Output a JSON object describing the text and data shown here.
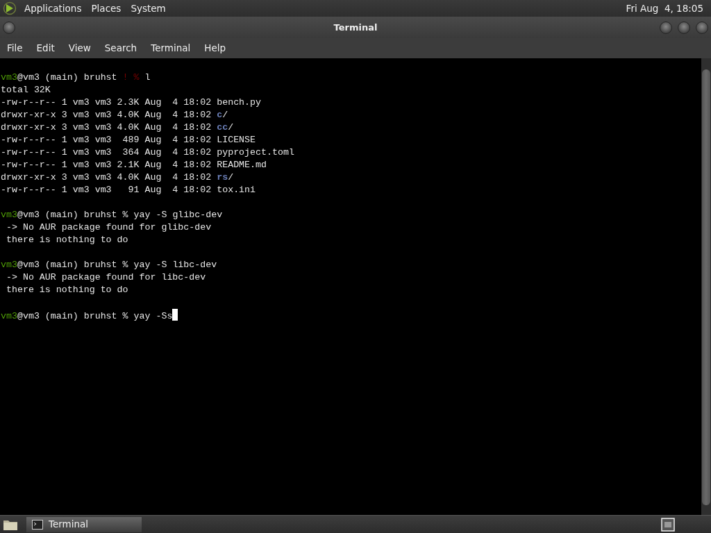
{
  "top_panel": {
    "menus": [
      "Applications",
      "Places",
      "System"
    ],
    "clock": "Fri Aug  4, 18:05"
  },
  "window": {
    "title": "Terminal"
  },
  "menu_bar": [
    "File",
    "Edit",
    "View",
    "Search",
    "Terminal",
    "Help"
  ],
  "terminal": {
    "blocks": [
      {
        "lines": [
          [
            {
              "text": "vm3",
              "kind": "user"
            },
            {
              "text": "@vm3 (main) bruhst ",
              "kind": "plain"
            },
            {
              "text": "! %",
              "kind": "alert"
            },
            {
              "text": " l",
              "kind": "plain"
            }
          ],
          [
            {
              "text": "total 32K",
              "kind": "plain"
            }
          ],
          [
            {
              "text": "-rw-r--r-- 1 vm3 vm3 2.3K Aug  4 18:02 bench.py",
              "kind": "plain"
            }
          ],
          [
            {
              "text": "drwxr-xr-x 3 vm3 vm3 4.0K Aug  4 18:02 ",
              "kind": "plain"
            },
            {
              "text": "c",
              "kind": "dir"
            },
            {
              "text": "/",
              "kind": "plain"
            }
          ],
          [
            {
              "text": "drwxr-xr-x 3 vm3 vm3 4.0K Aug  4 18:02 ",
              "kind": "plain"
            },
            {
              "text": "cc",
              "kind": "dir"
            },
            {
              "text": "/",
              "kind": "plain"
            }
          ],
          [
            {
              "text": "-rw-r--r-- 1 vm3 vm3  489 Aug  4 18:02 LICENSE",
              "kind": "plain"
            }
          ],
          [
            {
              "text": "-rw-r--r-- 1 vm3 vm3  364 Aug  4 18:02 pyproject.toml",
              "kind": "plain"
            }
          ],
          [
            {
              "text": "-rw-r--r-- 1 vm3 vm3 2.1K Aug  4 18:02 README.md",
              "kind": "plain"
            }
          ],
          [
            {
              "text": "drwxr-xr-x 3 vm3 vm3 4.0K Aug  4 18:02 ",
              "kind": "plain"
            },
            {
              "text": "rs",
              "kind": "dir"
            },
            {
              "text": "/",
              "kind": "plain"
            }
          ],
          [
            {
              "text": "-rw-r--r-- 1 vm3 vm3   91 Aug  4 18:02 tox.ini",
              "kind": "plain"
            }
          ]
        ]
      },
      {
        "lines": [
          [
            {
              "text": "vm3",
              "kind": "user"
            },
            {
              "text": "@vm3 (main) bruhst % yay -S glibc-dev",
              "kind": "plain"
            }
          ],
          [
            {
              "text": " -> No AUR package found for glibc-dev",
              "kind": "plain"
            }
          ],
          [
            {
              "text": " there is nothing to do",
              "kind": "plain"
            }
          ]
        ]
      },
      {
        "lines": [
          [
            {
              "text": "vm3",
              "kind": "user"
            },
            {
              "text": "@vm3 (main) bruhst % yay -S libc-dev",
              "kind": "plain"
            }
          ],
          [
            {
              "text": " -> No AUR package found for libc-dev",
              "kind": "plain"
            }
          ],
          [
            {
              "text": " there is nothing to do",
              "kind": "plain"
            }
          ]
        ]
      },
      {
        "lines": [
          [
            {
              "text": "vm3",
              "kind": "user"
            },
            {
              "text": "@vm3 (main) bruhst % yay -Ss",
              "kind": "plain"
            }
          ]
        ],
        "cursor": true
      }
    ]
  },
  "taskbar": {
    "tasks": [
      {
        "label": "Terminal",
        "selected": true
      }
    ]
  }
}
